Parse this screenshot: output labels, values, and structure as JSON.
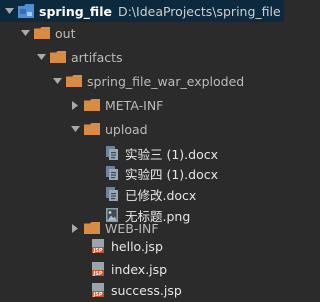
{
  "project": {
    "name": "spring_file",
    "path": "D:\\IdeaProjects\\spring_file"
  },
  "tree": {
    "out": "out",
    "artifacts": "artifacts",
    "exploded": "spring_file_war_exploded",
    "meta_inf": "META-INF",
    "upload": "upload",
    "files": [
      "实验三 (1).docx",
      "实验四 (1).docx",
      "已修改.docx",
      "无标题.png"
    ],
    "web_inf": "WEB-INF",
    "jsps": [
      "hello.jsp",
      "index.jsp",
      "success.jsp"
    ]
  },
  "colors": {
    "background": "#2b2b2b",
    "selection": "#0d293e",
    "folder": "#d98b44",
    "project_folder": "#4f8fd6",
    "text": "#bbbbbb"
  },
  "icons": {
    "project": "project-folder-icon",
    "folder": "folder-icon",
    "docx": "docx-file-icon",
    "png": "image-file-icon",
    "jsp": "jsp-file-icon",
    "expanded": "chevron-down-icon",
    "collapsed": "chevron-right-icon"
  }
}
